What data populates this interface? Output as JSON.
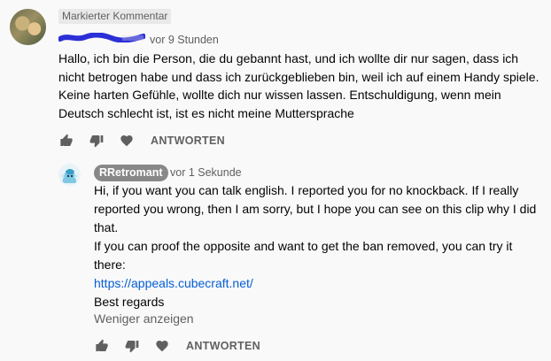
{
  "colors": {
    "background": "#f9f9f9",
    "text": "#030303",
    "secondary": "#606060",
    "link": "#065fd4",
    "badge": "#e9e9e9",
    "author_chip": "#888888",
    "redaction": "#2b2fd6"
  },
  "pinned": {
    "label": "Markierter Kommentar"
  },
  "main_comment": {
    "time": "vor 9 Stunden",
    "text": "Hallo, ich bin die Person, die du gebannt hast, und ich wollte dir nur sagen, dass ich nicht betrogen habe und dass ich zurückgeblieben bin, weil ich auf einem Handy spiele. Keine harten Gefühle, wollte dich nur wissen lassen. Entschuldigung, wenn mein Deutsch schlecht ist, ist es nicht meine Muttersprache",
    "reply_label": "ANTWORTEN",
    "icons": [
      "thumb-up-icon",
      "thumb-down-icon",
      "heart-icon"
    ]
  },
  "reply": {
    "author": "RRetromant",
    "time": "vor 1 Sekunde",
    "line1": "Hi, if you want you can talk english. I reported you for no knockback. If I really reported you wrong, then I am sorry, but I hope you can see on this clip why I did that.",
    "line2": "If you can proof the opposite and want to get the ban removed, you can try it there:",
    "link": "https://appeals.cubecraft.net/",
    "line3": "Best regards",
    "show_less": "Weniger anzeigen",
    "reply_label": "ANTWORTEN",
    "icons": [
      "thumb-up-icon",
      "thumb-down-icon",
      "heart-icon"
    ]
  }
}
